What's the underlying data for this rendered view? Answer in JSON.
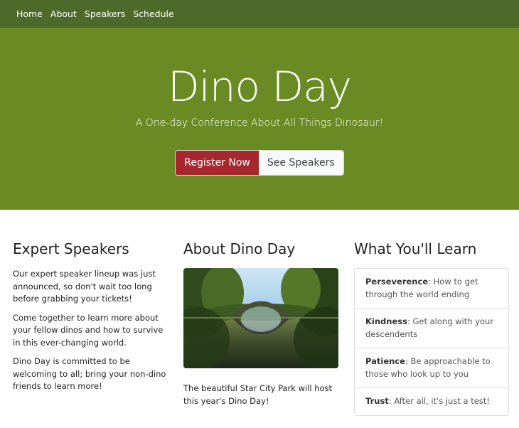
{
  "nav": {
    "items": [
      "Home",
      "About",
      "Speakers",
      "Schedule"
    ]
  },
  "hero": {
    "title": "Dino Day",
    "subtitle": "A One-day Conference About All Things Dinosaur!",
    "register_label": "Register Now",
    "speakers_label": "See Speakers"
  },
  "speakers": {
    "heading": "Expert Speakers",
    "paragraphs": [
      "Our expert speaker lineup was just announced, so don't wait too long before grabbing your tickets!",
      "Come together to learn more about your fellow dinos and how to survive in this ever-changing world.",
      "Dino Day is committed to be welcoming to all; bring your non-dino friends to learn more!"
    ]
  },
  "about": {
    "heading": "About Dino Day",
    "caption": "The beautiful Star City Park will host this year's Dino Day!"
  },
  "learn": {
    "heading": "What You'll Learn",
    "items": [
      {
        "term": "Perseverence",
        "text": ": How to get through the world ending"
      },
      {
        "term": "Kindness",
        "text": ": Get along with your descendents"
      },
      {
        "term": "Patience",
        "text": ": Be approachable to those who look up to you"
      },
      {
        "term": "Trust",
        "text": ": After all, it's just a test!"
      }
    ]
  },
  "colors": {
    "navbar": "#4e6a2b",
    "hero": "#6a8b23",
    "register": "#a8272f"
  }
}
